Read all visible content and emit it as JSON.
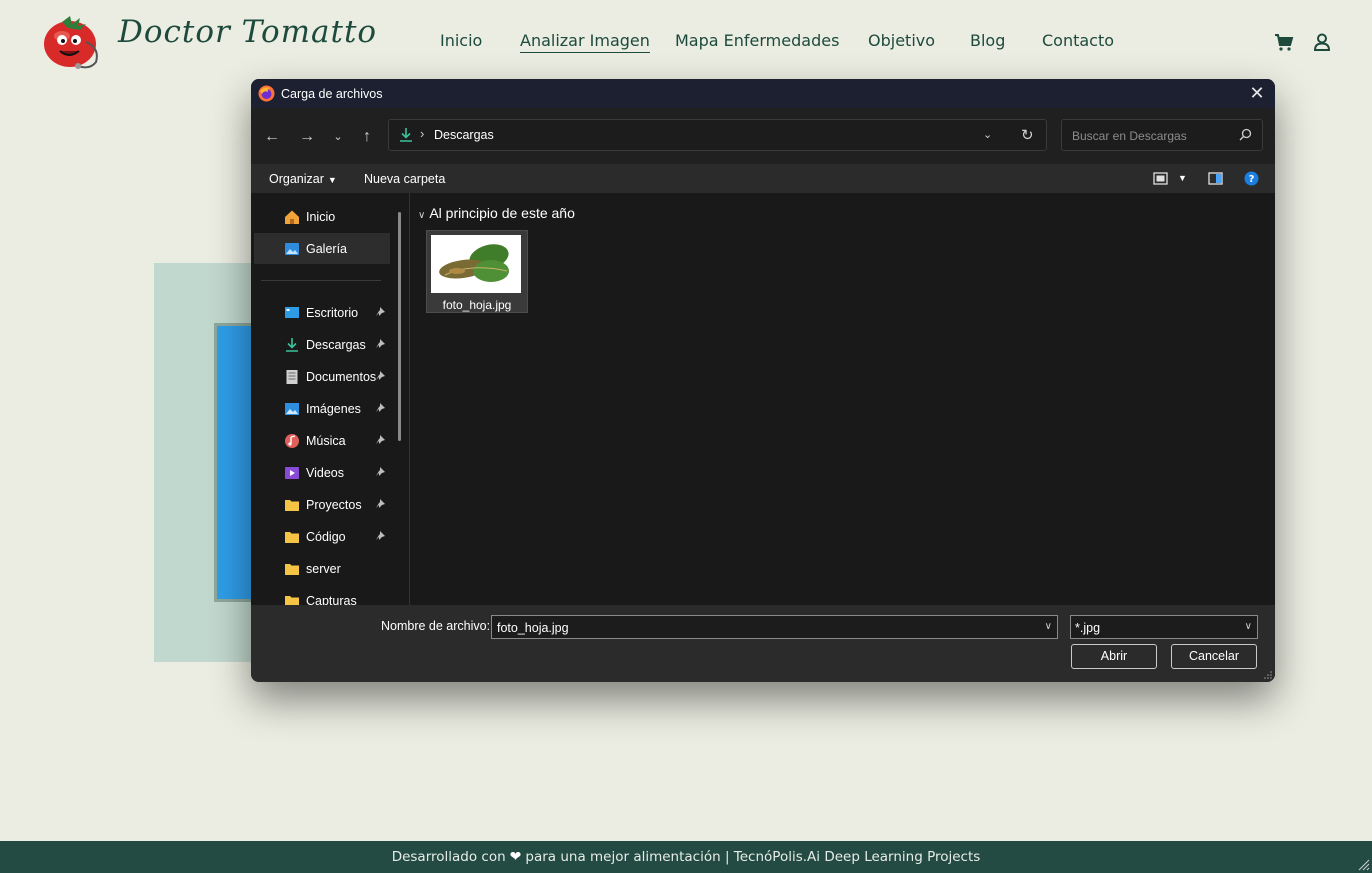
{
  "site": {
    "brand": "Doctor Tomatto",
    "nav": [
      "Inicio",
      "Analizar Imagen",
      "Mapa Enfermedades",
      "Objetivo",
      "Blog",
      "Contacto"
    ],
    "active_nav": "Analizar Imagen",
    "icons": [
      "cart-icon",
      "user-icon"
    ],
    "colors": {
      "background": "#ebede2",
      "brand_green": "#1d4a3c",
      "footer_bg": "#234a43"
    }
  },
  "footer": {
    "text_before": "Desarrollado con",
    "text_after": "para una mejor alimentación | TecnóPolis.Ai Deep Learning Projects",
    "heart_icon": "heart-icon"
  },
  "dialog": {
    "title": "Carga de archivos",
    "address": {
      "separator": "›",
      "crumb": "Descargas"
    },
    "search_placeholder": "Buscar en Descargas",
    "toolbar": {
      "organize": "Organizar",
      "new_folder": "Nueva carpeta"
    },
    "sidebar": {
      "top": [
        {
          "label": "Inicio",
          "icon": "home-icon"
        },
        {
          "label": "Galería",
          "icon": "gallery-icon",
          "selected": true
        }
      ],
      "pinned": [
        {
          "label": "Escritorio",
          "icon": "desktop-icon",
          "pinned": true
        },
        {
          "label": "Descargas",
          "icon": "download-icon",
          "pinned": true
        },
        {
          "label": "Documentos",
          "icon": "documents-icon",
          "pinned": true
        },
        {
          "label": "Imágenes",
          "icon": "pictures-icon",
          "pinned": true
        },
        {
          "label": "Música",
          "icon": "music-icon",
          "pinned": true
        },
        {
          "label": "Videos",
          "icon": "videos-icon",
          "pinned": true
        },
        {
          "label": "Proyectos",
          "icon": "folder-icon",
          "pinned": true
        },
        {
          "label": "Código",
          "icon": "folder-icon",
          "pinned": true
        },
        {
          "label": "server",
          "icon": "folder-icon",
          "pinned": false
        },
        {
          "label": "Capturas",
          "icon": "folder-icon",
          "pinned": false
        }
      ]
    },
    "group_header": "Al principio de este año",
    "files": [
      {
        "name": "foto_hoja.jpg",
        "thumbnail": "leaf-photo"
      }
    ],
    "filename_label": "Nombre de archivo:",
    "filename_value": "foto_hoja.jpg",
    "filetype": "*.jpg",
    "buttons": {
      "open": "Abrir",
      "cancel": "Cancelar"
    }
  }
}
